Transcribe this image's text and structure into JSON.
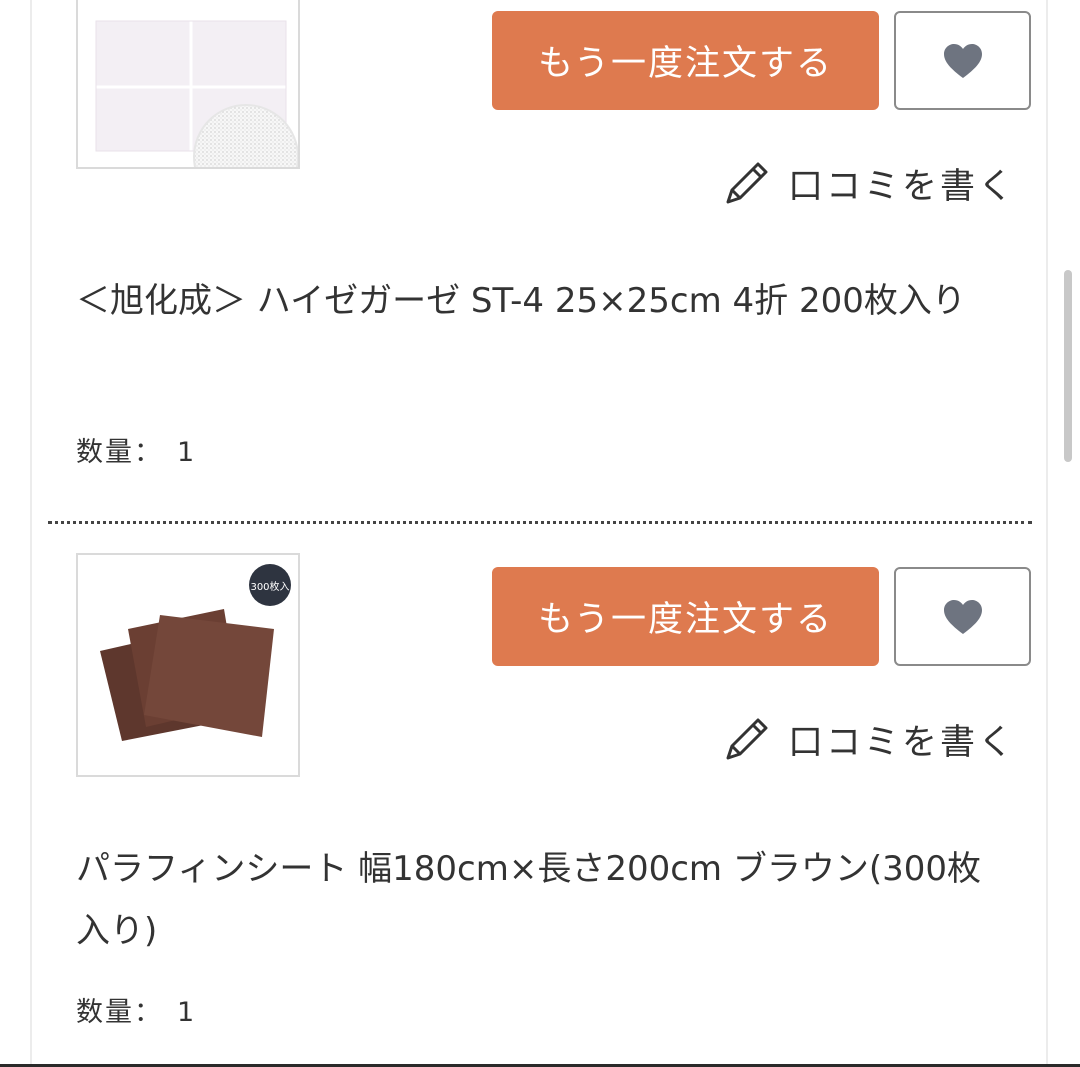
{
  "items": [
    {
      "name": "＜旭化成＞ ハイゼガーゼ ST-4 25×25cm 4折 200枚入り",
      "qty_label": "数量：",
      "qty_value": "1",
      "reorder_label": "もう一度注文する",
      "review_label": "口コミを書く",
      "image_icon": "gauze-sheet-image"
    },
    {
      "name": "パラフィンシート 幅180cm×長さ200cm ブラウン(300枚入り)",
      "qty_label": "数量：",
      "qty_value": "1",
      "reorder_label": "もう一度注文する",
      "review_label": "口コミを書く",
      "image_icon": "paraffin-sheet-image",
      "image_badge": "300枚入"
    }
  ],
  "colors": {
    "accent": "#de7a4f",
    "heart": "#6e7480",
    "sheet_brown": "#6b3f33"
  }
}
